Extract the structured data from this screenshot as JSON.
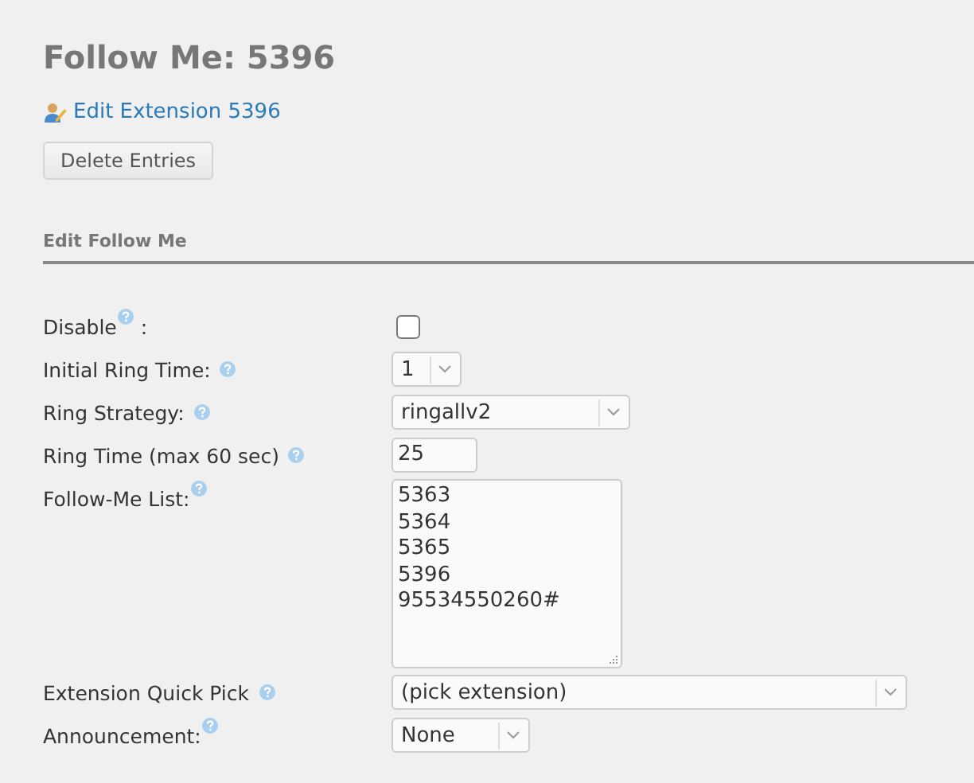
{
  "title": "Follow Me: 5396",
  "edit_link": "Edit Extension 5396",
  "delete_button": "Delete Entries",
  "section_title": "Edit Follow Me",
  "fields": [
    {
      "kind": "checkbox",
      "label": "Disable",
      "suffix": ":",
      "checked": false
    },
    {
      "kind": "select",
      "label": "Initial Ring Time:",
      "value": "1"
    },
    {
      "kind": "select",
      "label": "Ring Strategy:",
      "value": "ringallv2"
    },
    {
      "kind": "input",
      "label": "Ring Time (max 60 sec)",
      "value": "25"
    },
    {
      "kind": "textarea",
      "label": "Follow-Me List:",
      "lines": [
        "5363",
        "5364",
        "5365",
        "5396",
        "95534550260#"
      ]
    },
    {
      "kind": "select",
      "label": "Extension Quick Pick",
      "value": "(pick extension)"
    },
    {
      "kind": "select",
      "label": "Announcement:",
      "value": "None"
    }
  ]
}
